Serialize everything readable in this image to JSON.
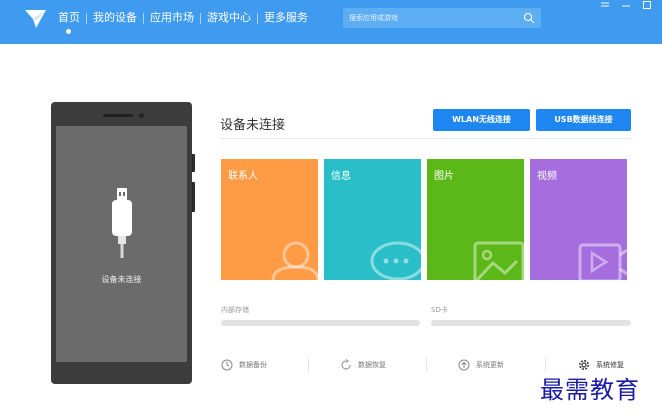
{
  "header": {
    "nav": [
      {
        "label": "首页",
        "active": true
      },
      {
        "label": "我的设备"
      },
      {
        "label": "应用市场"
      },
      {
        "label": "游戏中心"
      },
      {
        "label": "更多服务"
      }
    ],
    "search_placeholder": "搜索应用或游戏",
    "accent_color": "#3f9bf0"
  },
  "phone": {
    "status": "设备未连接"
  },
  "main": {
    "title": "设备未连接",
    "wlan_button": "WLAN无线连接",
    "usb_button": "USB数据线连接",
    "tiles": [
      {
        "label": "联系人",
        "color": "#ff9a45",
        "icon": "contacts-icon"
      },
      {
        "label": "信息",
        "color": "#2abfc8",
        "icon": "message-icon"
      },
      {
        "label": "图片",
        "color": "#5bb818",
        "icon": "picture-icon"
      },
      {
        "label": "视频",
        "color": "#a66dde",
        "icon": "video-icon"
      }
    ],
    "storage": {
      "internal_label": "内部存储",
      "sd_label": "SD卡"
    },
    "tools": [
      {
        "label": "数据备份",
        "icon": "backup-clock-icon"
      },
      {
        "label": "数据恢复",
        "icon": "restore-icon"
      },
      {
        "label": "系统更新",
        "icon": "update-arrow-icon"
      },
      {
        "label": "系统修复",
        "icon": "gear-icon"
      }
    ]
  },
  "watermark": "最需教育"
}
